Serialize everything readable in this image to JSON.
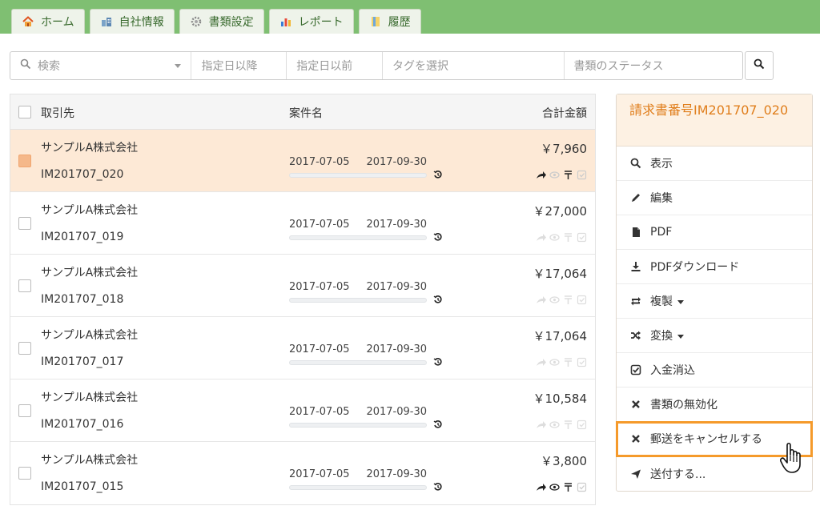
{
  "nav": {
    "tabs": [
      {
        "label": "ホーム",
        "icon": "home-icon"
      },
      {
        "label": "自社情報",
        "icon": "company-icon"
      },
      {
        "label": "書類設定",
        "icon": "gear-icon"
      },
      {
        "label": "レポート",
        "icon": "chart-icon"
      },
      {
        "label": "履歴",
        "icon": "history-icon"
      }
    ]
  },
  "search": {
    "keyword_placeholder": "検索",
    "date_from_placeholder": "指定日以降",
    "date_to_placeholder": "指定日以前",
    "tag_placeholder": "タグを選択",
    "status_placeholder": "書類のステータス"
  },
  "table": {
    "headers": {
      "client": "取引先",
      "case": "案件名",
      "total": "合計金額"
    },
    "rows": [
      {
        "client": "サンプルA株式会社",
        "code": "IM201707_020",
        "start": "2017-07-05",
        "end": "2017-09-30",
        "amount": "￥7,960",
        "selected": true
      },
      {
        "client": "サンプルA株式会社",
        "code": "IM201707_019",
        "start": "2017-07-05",
        "end": "2017-09-30",
        "amount": "￥27,000",
        "selected": false
      },
      {
        "client": "サンプルA株式会社",
        "code": "IM201707_018",
        "start": "2017-07-05",
        "end": "2017-09-30",
        "amount": "￥17,064",
        "selected": false
      },
      {
        "client": "サンプルA株式会社",
        "code": "IM201707_017",
        "start": "2017-07-05",
        "end": "2017-09-30",
        "amount": "￥17,064",
        "selected": false
      },
      {
        "client": "サンプルA株式会社",
        "code": "IM201707_016",
        "start": "2017-07-05",
        "end": "2017-09-30",
        "amount": "￥10,584",
        "selected": false
      },
      {
        "client": "サンプルA株式会社",
        "code": "IM201707_015",
        "start": "2017-07-05",
        "end": "2017-09-30",
        "amount": "￥3,800",
        "selected": false
      }
    ]
  },
  "panel": {
    "title": "請求書番号IM201707_020",
    "actions": [
      {
        "label": "表示",
        "icon": "search-icon"
      },
      {
        "label": "編集",
        "icon": "pencil-icon"
      },
      {
        "label": "PDF",
        "icon": "file-icon"
      },
      {
        "label": "PDFダウンロード",
        "icon": "download-icon"
      },
      {
        "label": "複製",
        "icon": "retweet-icon"
      },
      {
        "label": "変換",
        "icon": "shuffle-icon"
      },
      {
        "label": "入金消込",
        "icon": "check-square-icon"
      },
      {
        "label": "書類の無効化",
        "icon": "x-icon"
      },
      {
        "label": "郵送をキャンセルする",
        "icon": "x-icon"
      },
      {
        "label": "送付する...",
        "icon": "send-icon"
      }
    ]
  },
  "colors": {
    "nav_green": "#7fbf72",
    "accent_orange": "#e07e1c",
    "selected_row": "#fde9d6",
    "highlight": "#f59a2b"
  }
}
